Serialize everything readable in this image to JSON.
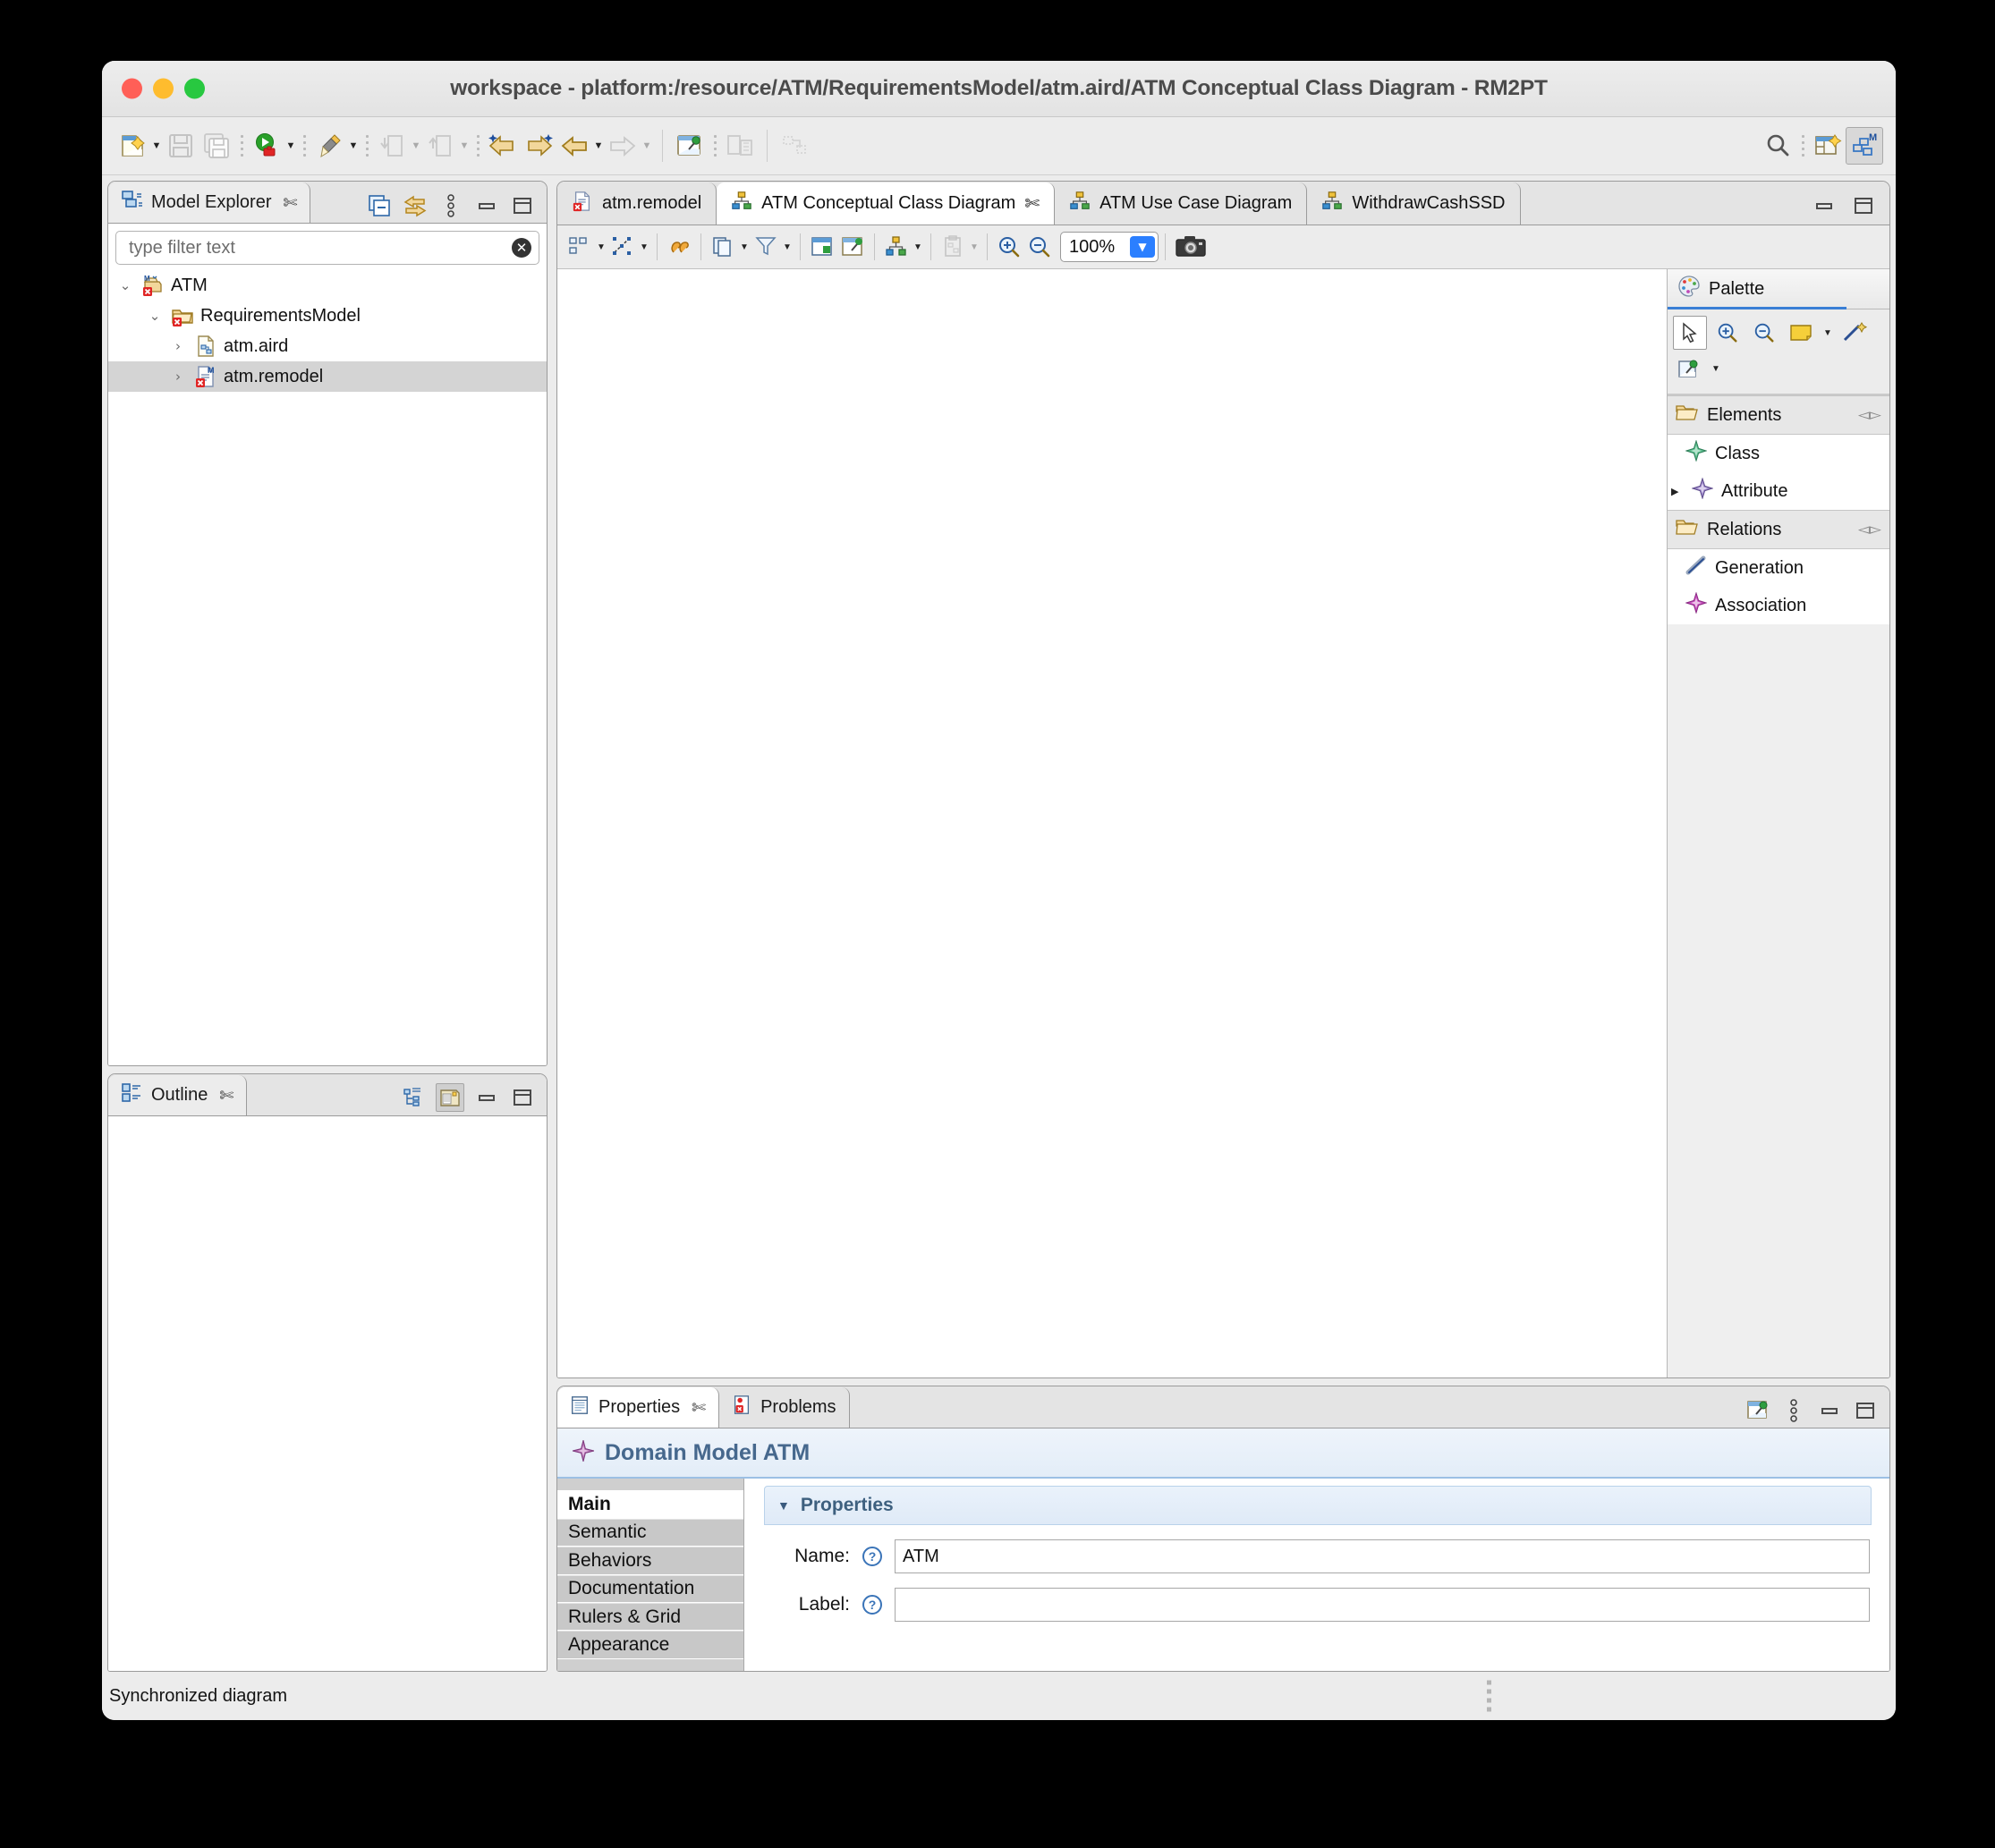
{
  "window": {
    "title": "workspace - platform:/resource/ATM/RequirementsModel/atm.aird/ATM Conceptual Class Diagram - RM2PT",
    "traffic": {
      "close": "close-window",
      "minimize": "minimize-window",
      "zoom": "zoom-window"
    }
  },
  "main_toolbar": {
    "items": [
      {
        "name": "new-wizard",
        "icon": "new-document-icon",
        "dropdown": true,
        "enabled": true
      },
      {
        "name": "save",
        "icon": "save-icon",
        "dropdown": false,
        "enabled": false
      },
      {
        "name": "save-all",
        "icon": "save-all-icon",
        "dropdown": false,
        "enabled": false
      },
      {
        "name": "run",
        "icon": "run-icon",
        "dropdown": true,
        "enabled": true
      },
      {
        "name": "debug-pen",
        "icon": "pen-icon",
        "dropdown": true,
        "enabled": true
      },
      {
        "name": "import",
        "icon": "import-icon",
        "dropdown": true,
        "enabled": false
      },
      {
        "name": "export",
        "icon": "export-icon",
        "dropdown": true,
        "enabled": false
      },
      {
        "name": "previous-annotation",
        "icon": "back-star-icon",
        "dropdown": false,
        "enabled": true
      },
      {
        "name": "next-annotation",
        "icon": "forward-star-icon",
        "dropdown": false,
        "enabled": true
      },
      {
        "name": "back",
        "icon": "back-arrow-icon",
        "dropdown": true,
        "enabled": true
      },
      {
        "name": "forward",
        "icon": "forward-arrow-icon",
        "dropdown": true,
        "enabled": false
      },
      {
        "name": "pin-editor",
        "icon": "pin-icon",
        "dropdown": false,
        "enabled": true
      },
      {
        "name": "new-window",
        "icon": "new-window-icon",
        "dropdown": false,
        "enabled": false
      },
      {
        "name": "layout",
        "icon": "layout-icon",
        "dropdown": false,
        "enabled": false
      }
    ],
    "right": [
      {
        "name": "quick-access-search",
        "icon": "search-icon"
      },
      {
        "name": "open-perspective",
        "icon": "open-perspective-icon"
      },
      {
        "name": "modeling-perspective",
        "icon": "modeling-perspective-icon",
        "active": true
      }
    ]
  },
  "model_explorer": {
    "tab_label": "Model Explorer",
    "tab_icon": "model-explorer-icon",
    "toolbar": [
      {
        "name": "collapse-all",
        "icon": "collapse-all-icon"
      },
      {
        "name": "link-with-editor",
        "icon": "link-editor-icon"
      },
      {
        "name": "view-menu",
        "icon": "view-menu-icon"
      },
      {
        "name": "minimize",
        "icon": "minimize-icon"
      },
      {
        "name": "maximize",
        "icon": "maximize-icon"
      }
    ],
    "filter": {
      "placeholder": "type filter text",
      "value": "",
      "clear_icon": "clear-icon"
    },
    "tree": [
      {
        "label": "ATM",
        "depth": 0,
        "expanded": true,
        "icon": "project-error-icon",
        "selected": false
      },
      {
        "label": "RequirementsModel",
        "depth": 1,
        "expanded": true,
        "icon": "folder-error-icon",
        "selected": false
      },
      {
        "label": "atm.aird",
        "depth": 2,
        "expanded": false,
        "icon": "aird-file-icon",
        "selected": false
      },
      {
        "label": "atm.remodel",
        "depth": 2,
        "expanded": false,
        "icon": "remodel-file-error-icon",
        "selected": true
      }
    ]
  },
  "outline": {
    "tab_label": "Outline",
    "tab_icon": "outline-icon",
    "toolbar": [
      {
        "name": "tree-outline-mode",
        "icon": "tree-outline-icon",
        "pressed": false
      },
      {
        "name": "overview-mode",
        "icon": "overview-icon",
        "pressed": true
      },
      {
        "name": "minimize",
        "icon": "minimize-icon"
      },
      {
        "name": "maximize",
        "icon": "maximize-icon"
      }
    ]
  },
  "editor": {
    "tabs": [
      {
        "label": "atm.remodel",
        "icon": "remodel-file-error-icon",
        "active": false,
        "closable": false
      },
      {
        "label": "ATM Conceptual Class Diagram",
        "icon": "diagram-icon",
        "active": true,
        "closable": true
      },
      {
        "label": "ATM Use Case Diagram",
        "icon": "diagram-icon",
        "active": false,
        "closable": false
      },
      {
        "label": "WithdrawCashSSD",
        "icon": "diagram-icon",
        "active": false,
        "closable": false
      }
    ],
    "tab_controls": [
      {
        "name": "minimize",
        "icon": "minimize-icon"
      },
      {
        "name": "maximize",
        "icon": "maximize-icon"
      }
    ],
    "toolbar": [
      {
        "name": "arrange-selection",
        "icon": "arrange-icon",
        "dropdown": true,
        "enabled": true
      },
      {
        "name": "select-layout",
        "icon": "select-layout-icon",
        "dropdown": true,
        "enabled": true
      },
      {
        "name": "refresh-diagram",
        "icon": "refresh-icon",
        "dropdown": false,
        "enabled": true
      },
      {
        "name": "layer-filter",
        "icon": "layers-icon",
        "dropdown": true,
        "enabled": true
      },
      {
        "name": "filter",
        "icon": "filter-icon",
        "dropdown": true,
        "enabled": true
      },
      {
        "name": "hide-element",
        "icon": "hide-icon",
        "dropdown": false,
        "enabled": true
      },
      {
        "name": "pin-element",
        "icon": "pin-element-icon",
        "dropdown": false,
        "enabled": true
      },
      {
        "name": "layout-tree",
        "icon": "tree-layout-icon",
        "dropdown": true,
        "enabled": true
      },
      {
        "name": "paste-format",
        "icon": "paste-format-icon",
        "dropdown": true,
        "enabled": false
      },
      {
        "name": "zoom-in",
        "icon": "zoom-in-icon",
        "dropdown": false,
        "enabled": true
      },
      {
        "name": "zoom-out",
        "icon": "zoom-out-icon",
        "dropdown": false,
        "enabled": true
      }
    ],
    "zoom": {
      "value": "100%",
      "dropdown_icon": "chevron-down-icon"
    },
    "screenshot_button": {
      "name": "export-diagram-image",
      "icon": "camera-icon"
    }
  },
  "palette": {
    "title": "Palette",
    "title_icon": "palette-icon",
    "tools": [
      {
        "name": "select-tool",
        "icon": "pointer-icon",
        "selected": true,
        "dropdown": false
      },
      {
        "name": "zoom-in-tool",
        "icon": "zoom-in-icon",
        "selected": false,
        "dropdown": false
      },
      {
        "name": "zoom-out-tool",
        "icon": "zoom-out-icon",
        "selected": false,
        "dropdown": false
      },
      {
        "name": "note-tool",
        "icon": "note-icon",
        "selected": false,
        "dropdown": true
      },
      {
        "name": "note-attachment-tool",
        "icon": "note-link-icon",
        "selected": false,
        "dropdown": false
      },
      {
        "name": "generic-element-tool",
        "icon": "generic-element-icon",
        "selected": false,
        "dropdown": true
      }
    ],
    "sections": [
      {
        "title": "Elements",
        "icon": "open-folder-icon",
        "collapse_icon": "collapse-section-icon",
        "items": [
          {
            "label": "Class",
            "icon": "class-green-icon",
            "expandable": false
          },
          {
            "label": "Attribute",
            "icon": "attribute-purple-icon",
            "expandable": true
          }
        ]
      },
      {
        "title": "Relations",
        "icon": "open-folder-icon",
        "collapse_icon": "collapse-section-icon",
        "items": [
          {
            "label": "Generation",
            "icon": "generation-line-icon",
            "expandable": false
          },
          {
            "label": "Association",
            "icon": "association-magenta-icon",
            "expandable": false
          }
        ]
      }
    ]
  },
  "properties": {
    "tabs": [
      {
        "label": "Properties",
        "icon": "properties-icon",
        "active": true,
        "closable": true
      },
      {
        "label": "Problems",
        "icon": "problems-icon",
        "active": false,
        "closable": false
      }
    ],
    "toolbar": [
      {
        "name": "pin-properties",
        "icon": "pin-icon"
      },
      {
        "name": "view-menu",
        "icon": "view-menu-icon"
      },
      {
        "name": "minimize",
        "icon": "minimize-icon"
      },
      {
        "name": "maximize",
        "icon": "maximize-icon"
      }
    ],
    "header": {
      "icon": "domain-model-icon",
      "title": "Domain Model ATM"
    },
    "side_tabs": [
      {
        "label": "Main",
        "active": true
      },
      {
        "label": "Semantic",
        "active": false
      },
      {
        "label": "Behaviors",
        "active": false
      },
      {
        "label": "Documentation",
        "active": false
      },
      {
        "label": "Rulers & Grid",
        "active": false
      },
      {
        "label": "Appearance",
        "active": false
      }
    ],
    "section": {
      "title": "Properties",
      "expanded": true,
      "twisty_icon": "triangle-down-icon"
    },
    "fields": [
      {
        "label": "Name:",
        "value": "ATM",
        "help_icon": "help-icon",
        "name": "name-field"
      },
      {
        "label": "Label:",
        "value": "",
        "help_icon": "help-icon",
        "name": "label-field"
      }
    ]
  },
  "status_bar": {
    "message": "Synchronized diagram",
    "handle_icon": "resize-handle-icon"
  },
  "colors": {
    "accent_blue": "#2b7fff",
    "selection_gray": "#d4d4d4",
    "props_title": "#46688d",
    "window_chrome": "#ececec"
  }
}
